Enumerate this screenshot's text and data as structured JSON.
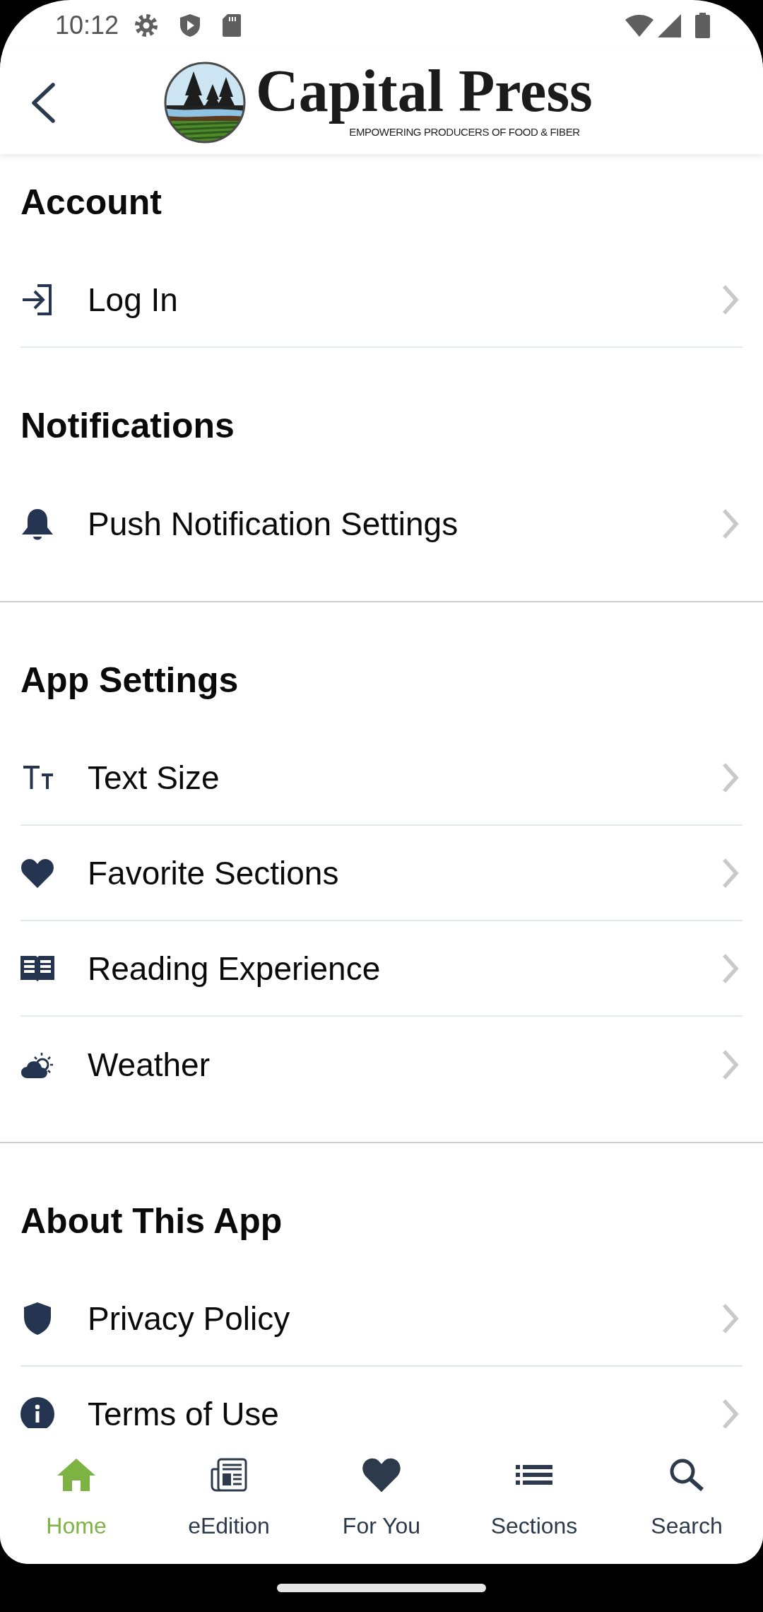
{
  "status_bar": {
    "time": "10:12"
  },
  "header": {
    "title": "Capital Press",
    "tagline": "EMPOWERING PRODUCERS OF FOOD & FIBER"
  },
  "sections": [
    {
      "title": "Account",
      "full_divider": false,
      "items": [
        {
          "label": "Log In"
        }
      ]
    },
    {
      "title": "Notifications",
      "full_divider": true,
      "items": [
        {
          "label": "Push Notification Settings"
        }
      ]
    },
    {
      "title": "App Settings",
      "full_divider": true,
      "items": [
        {
          "label": "Text Size"
        },
        {
          "label": "Favorite Sections"
        },
        {
          "label": "Reading Experience"
        },
        {
          "label": "Weather"
        }
      ]
    },
    {
      "title": "About This App",
      "items": [
        {
          "label": "Privacy Policy"
        },
        {
          "label": "Terms of Use"
        }
      ]
    }
  ],
  "bottom_nav": [
    {
      "label": "Home",
      "selected": true
    },
    {
      "label": "eEdition",
      "selected": false
    },
    {
      "label": "For You",
      "selected": false
    },
    {
      "label": "Sections",
      "selected": false
    },
    {
      "label": "Search",
      "selected": false
    }
  ]
}
